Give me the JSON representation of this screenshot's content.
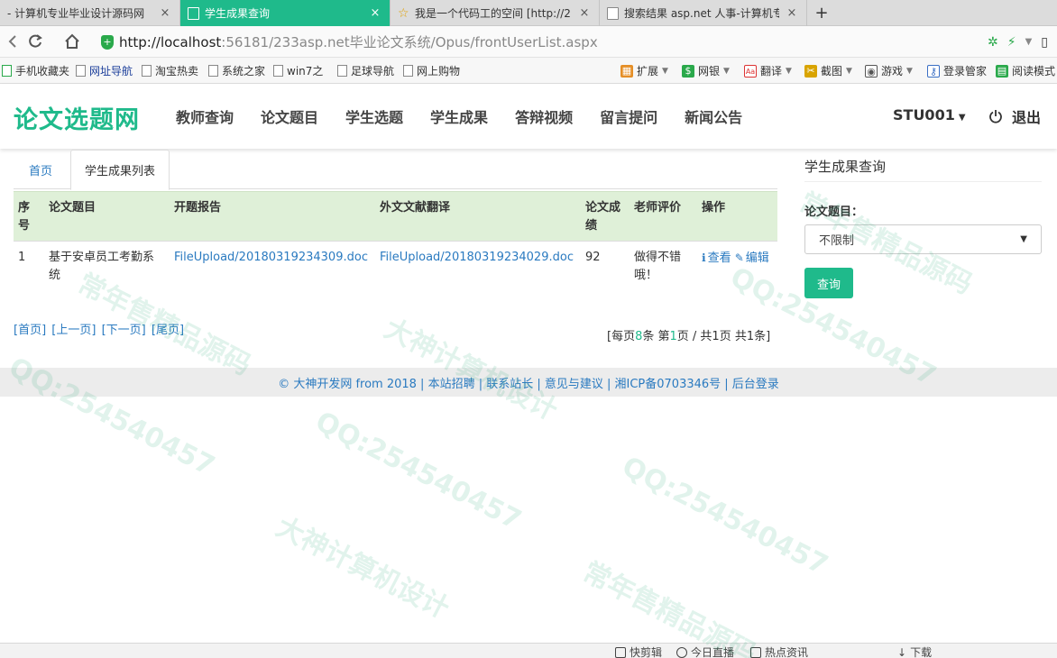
{
  "browser": {
    "tabs": [
      {
        "label": "- 计算机专业毕业设计源码网",
        "close": "×"
      },
      {
        "label": "学生成果查询",
        "close": "×"
      },
      {
        "label": "我是一个代码工的空间 [http://2",
        "close": "×"
      },
      {
        "label": "搜索结果 asp.net 人事-计算机专",
        "close": "×"
      }
    ],
    "new_tab": "+",
    "url_host": "http://localhost",
    "url_rest": ":56181/233asp.net毕业论文系统/Opus/frontUserList.aspx",
    "accent": "#1fba8b"
  },
  "bookmarks": {
    "left": [
      "手机收藏夹",
      "网址导航",
      "淘宝热卖",
      "系统之家",
      "win7之",
      "足球导航",
      "网上购物"
    ],
    "right": [
      "扩展",
      "网银",
      "翻译",
      "截图",
      "游戏",
      "登录管家",
      "阅读模式"
    ]
  },
  "header": {
    "brand": "论文选题网",
    "nav": [
      "教师查询",
      "论文题目",
      "学生选题",
      "学生成果",
      "答辩视频",
      "留言提问",
      "新闻公告"
    ],
    "user": "STU001",
    "logout": "退出"
  },
  "content": {
    "tabs": [
      "首页",
      "学生成果列表"
    ],
    "columns": [
      "序号",
      "论文题目",
      "开题报告",
      "外文文献翻译",
      "论文成绩",
      "老师评价",
      "操作"
    ],
    "rows": [
      {
        "no": "1",
        "title": "基于安卓员工考勤系统",
        "report": "FileUpload/20180319234309.doc",
        "translation": "FileUpload/20180319234029.doc",
        "score": "92",
        "comment": "做得不错哦！",
        "view": "查看",
        "edit": "编辑"
      }
    ],
    "pager": {
      "first": "[首页]",
      "prev": "[上一页]",
      "next": "[下一页]",
      "last": "[尾页]",
      "summary_prefix": "[每页",
      "per_page": "8",
      "summary_mid": "条 第",
      "current": "1",
      "summary_suffix": "页 / 共1页 共1条]"
    }
  },
  "sidebar": {
    "title": "学生成果查询",
    "field_label": "论文题目：",
    "select_value": "不限制",
    "search_button": "查询"
  },
  "footer": {
    "text": "© 大神开发网 from 2018 | 本站招聘 | 联系站长 | 意见与建议 | 湘ICP备0703346号 | 后台登录"
  },
  "statusbar": [
    "快剪辑",
    "今日直播",
    "热点资讯",
    "下载"
  ],
  "watermark": [
    "QQ:254540457",
    "大神计算机设计",
    "常年售精品源码"
  ]
}
